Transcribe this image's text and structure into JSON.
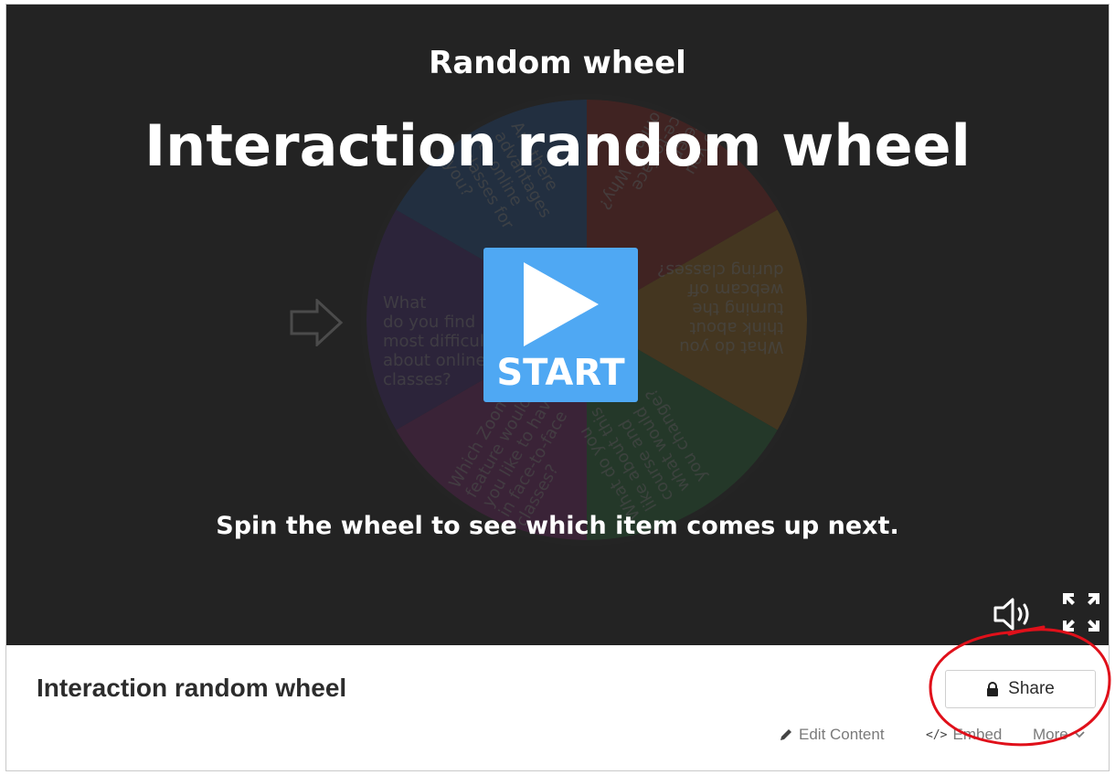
{
  "player": {
    "subtitle": "Random wheel",
    "title": "Interaction random wheel",
    "start_label": "START",
    "instructions": "Spin the wheel to see which item comes up next.",
    "wheel_items": [
      "What\ndo you find\nmost difficult\nabout online\nclasses?",
      "What do you\nthink about\nturning the\nwebcam off\nduring classes?",
      "What do you\nlike about this\ncourse and\nwhat would\nyou change?",
      "Which Zoom\nfeature would\nyou like to have\nin face-to-face\nclasses?",
      "Do you\nprefer\nface-to-face\nor online? Why?",
      "Are there\nadvantages\nto online\nclasses for\nyou?"
    ],
    "segment_colors": [
      "#1e6fd9",
      "#d9261e",
      "#f29b11",
      "#2aa84a",
      "#b0259e",
      "#5a2ab5"
    ],
    "controls": {
      "sound_icon": "speaker-icon",
      "fullscreen_icon": "fullscreen-icon"
    }
  },
  "footer": {
    "title": "Interaction random wheel",
    "share_label": "Share",
    "edit_label": "Edit Content",
    "embed_label": "Embed",
    "more_label": "More"
  },
  "colors": {
    "start_button": "#4fa8f3",
    "stage_background": "#232323",
    "annotation": "#e0101a"
  }
}
